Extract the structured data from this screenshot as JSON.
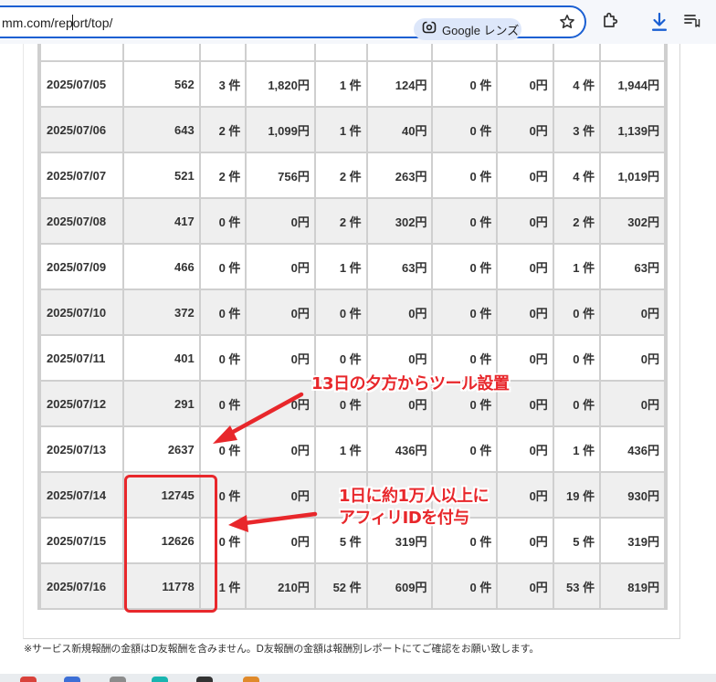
{
  "browser": {
    "url_before_caret": "mm.com/rep",
    "url_after_caret": "ort/top/",
    "lens_label": "Google レンズ",
    "icons": [
      "google-lens-icon",
      "bookmark-star-icon",
      "extensions-icon",
      "download-icon",
      "reading-list-icon"
    ]
  },
  "report": {
    "rows": [
      {
        "date": "2025/07/05",
        "clicks": "562",
        "c1": "3 件",
        "c2": "1,820円",
        "c3": "1 件",
        "c4": "124円",
        "c5": "0 件",
        "c6": "0円",
        "c7": "4 件",
        "c8": "1,944円"
      },
      {
        "date": "2025/07/06",
        "clicks": "643",
        "c1": "2 件",
        "c2": "1,099円",
        "c3": "1 件",
        "c4": "40円",
        "c5": "0 件",
        "c6": "0円",
        "c7": "3 件",
        "c8": "1,139円"
      },
      {
        "date": "2025/07/07",
        "clicks": "521",
        "c1": "2 件",
        "c2": "756円",
        "c3": "2 件",
        "c4": "263円",
        "c5": "0 件",
        "c6": "0円",
        "c7": "4 件",
        "c8": "1,019円"
      },
      {
        "date": "2025/07/08",
        "clicks": "417",
        "c1": "0 件",
        "c2": "0円",
        "c3": "2 件",
        "c4": "302円",
        "c5": "0 件",
        "c6": "0円",
        "c7": "2 件",
        "c8": "302円"
      },
      {
        "date": "2025/07/09",
        "clicks": "466",
        "c1": "0 件",
        "c2": "0円",
        "c3": "1 件",
        "c4": "63円",
        "c5": "0 件",
        "c6": "0円",
        "c7": "1 件",
        "c8": "63円"
      },
      {
        "date": "2025/07/10",
        "clicks": "372",
        "c1": "0 件",
        "c2": "0円",
        "c3": "0 件",
        "c4": "0円",
        "c5": "0 件",
        "c6": "0円",
        "c7": "0 件",
        "c8": "0円"
      },
      {
        "date": "2025/07/11",
        "clicks": "401",
        "c1": "0 件",
        "c2": "0円",
        "c3": "0 件",
        "c4": "0円",
        "c5": "0 件",
        "c6": "0円",
        "c7": "0 件",
        "c8": "0円"
      },
      {
        "date": "2025/07/12",
        "clicks": "291",
        "c1": "0 件",
        "c2": "0円",
        "c3": "0 件",
        "c4": "0円",
        "c5": "0 件",
        "c6": "0円",
        "c7": "0 件",
        "c8": "0円"
      },
      {
        "date": "2025/07/13",
        "clicks": "2637",
        "c1": "0 件",
        "c2": "0円",
        "c3": "1 件",
        "c4": "436円",
        "c5": "0 件",
        "c6": "0円",
        "c7": "1 件",
        "c8": "436円"
      },
      {
        "date": "2025/07/14",
        "clicks": "12745",
        "c1": "0 件",
        "c2": "0円",
        "c3": "1",
        "c4": "",
        "c5": "",
        "c6": "0円",
        "c7": "19 件",
        "c8": "930円"
      },
      {
        "date": "2025/07/15",
        "clicks": "12626",
        "c1": "0 件",
        "c2": "0円",
        "c3": "5 件",
        "c4": "319円",
        "c5": "0 件",
        "c6": "0円",
        "c7": "5 件",
        "c8": "319円"
      },
      {
        "date": "2025/07/16",
        "clicks": "11778",
        "c1": "1 件",
        "c2": "210円",
        "c3": "52 件",
        "c4": "609円",
        "c5": "0 件",
        "c6": "0円",
        "c7": "53 件",
        "c8": "819円"
      }
    ]
  },
  "annotations": {
    "tool_note": "13日の夕方からツール設置",
    "affiliate_note_line1": "1日に約1万人以上に",
    "affiliate_note_line2": "アフィリIDを付与",
    "accent_color": "#e8272b"
  },
  "footnote": "※サービス新規報酬の金額はD友報酬を含みません。D友報酬の金額は報酬別レポートにてご確認をお願い致します。"
}
